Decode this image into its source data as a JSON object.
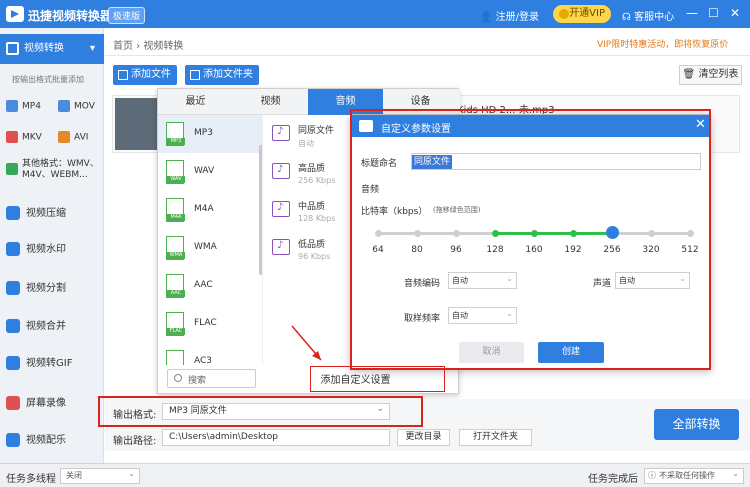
{
  "app": {
    "title": "迅捷视频转换器",
    "badge": "极速版"
  },
  "header": {
    "login": "注册/登录",
    "vip": "开通VIP",
    "help": "客服中心",
    "min": "—",
    "max": "☐",
    "close": "✕"
  },
  "sidebar": {
    "active": "视频转换",
    "hint": "按输出格式批量添加",
    "formats": [
      "MP4",
      "MOV",
      "MKV",
      "AVI"
    ],
    "other": "其他格式：WMV、M4V、WEBM...",
    "items": [
      "视频压缩",
      "视频水印",
      "视频分割",
      "视频合并",
      "视频转GIF",
      "屏幕录像",
      "视频配乐"
    ]
  },
  "main": {
    "breadcrumb": "首页 › 视频转换",
    "promo": "VIP限时特惠活动，即将恢复原价",
    "add_file": "添加文件",
    "add_folder": "添加文件夹",
    "clear_list": "清空列表",
    "file_name": "Kids HD 2...-未.mp3"
  },
  "format_panel": {
    "tabs": [
      "最近",
      "视频",
      "音频",
      "设备"
    ],
    "active_tab": "音频",
    "formats": [
      "MP3",
      "WAV",
      "M4A",
      "WMA",
      "AAC",
      "FLAC",
      "AC3"
    ],
    "qualities": [
      {
        "name": "同原文件",
        "sub": "自动"
      },
      {
        "name": "高品质",
        "sub": "256 Kbps"
      },
      {
        "name": "中品质",
        "sub": "128 Kbps"
      },
      {
        "name": "低品质",
        "sub": "96 Kbps"
      }
    ],
    "search_placeholder": "搜索",
    "add_custom": "添加自定义设置"
  },
  "dialog": {
    "title": "自定义参数设置",
    "name_label": "标题命名",
    "name_value": "同原文件",
    "audio_label": "音频",
    "bitrate_label": "比特率（kbps）",
    "bitrate_hint": "(拖移绿色范围)",
    "bitrate_ticks": [
      "64",
      "80",
      "96",
      "128",
      "160",
      "192",
      "256",
      "320",
      "512"
    ],
    "bitrate_value": 256,
    "bitrate_range": [
      128,
      256
    ],
    "encoding_label": "音频编码",
    "encoding_value": "自动",
    "channel_label": "声道",
    "channel_value": "自动",
    "sample_label": "取样频率",
    "sample_value": "自动",
    "cancel": "取消",
    "create": "创建"
  },
  "output": {
    "format_label": "输出格式:",
    "format_value": "MP3  同原文件",
    "path_label": "输出路径:",
    "path_value": "C:\\Users\\admin\\Desktop",
    "change_dir": "更改目录",
    "open_folder": "打开文件夹",
    "convert_all": "全部转换"
  },
  "status": {
    "multi_thread": "任务多线程",
    "multi_value": "关闭",
    "done_label": "任务完成后",
    "done_value": "不采取任何操作"
  },
  "colors": {
    "accent": "#2f7fe0",
    "highlight": "#d9231c",
    "range": "#2fbf4a"
  }
}
